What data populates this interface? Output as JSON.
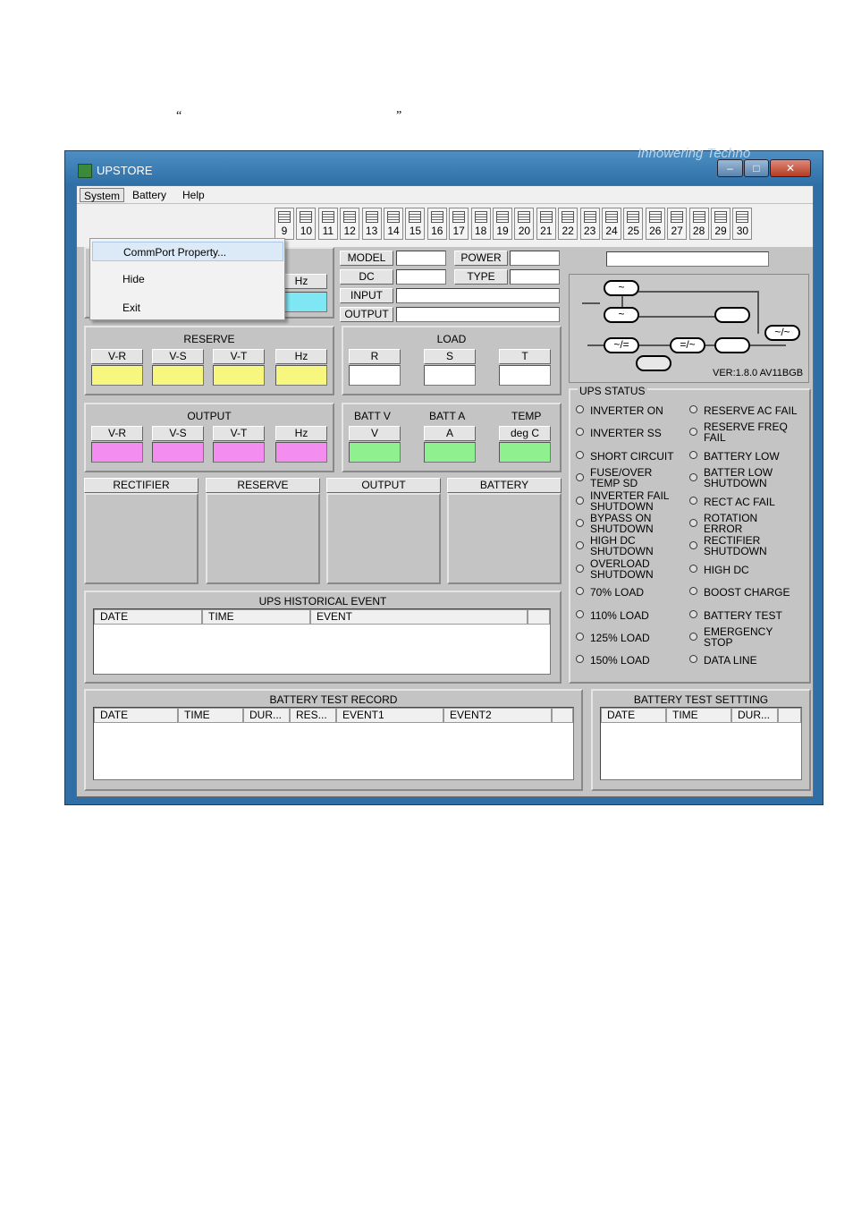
{
  "doc": {
    "quote_open": "“",
    "quote_close": "”"
  },
  "window": {
    "title": "UPSTORE",
    "brand": "Innowering Techno",
    "minimize": "‒",
    "maximize": "□",
    "close": "✕"
  },
  "menu": {
    "system": "System",
    "battery": "Battery",
    "help": "Help"
  },
  "dropdown": {
    "items": [
      "CommPort Property...",
      "Hide",
      "Exit"
    ]
  },
  "ports": [
    "9",
    "10",
    "11",
    "12",
    "13",
    "14",
    "15",
    "16",
    "17",
    "18",
    "19",
    "20",
    "21",
    "22",
    "23",
    "24",
    "25",
    "26",
    "27",
    "28",
    "29",
    "30"
  ],
  "rectifier_partial": {
    "hz": "Hz"
  },
  "reserve": {
    "title": "RESERVE",
    "labels": [
      "V-R",
      "V-S",
      "V-T",
      "Hz"
    ]
  },
  "output": {
    "title": "OUTPUT",
    "labels": [
      "V-R",
      "V-S",
      "V-T",
      "Hz"
    ]
  },
  "info": {
    "model": "MODEL",
    "power": "POWER",
    "dc": "DC",
    "type": "TYPE",
    "input": "INPUT",
    "output": "OUTPUT"
  },
  "load": {
    "title": "LOAD",
    "labels": [
      "R",
      "S",
      "T"
    ]
  },
  "batt": {
    "batt_v": "BATT  V",
    "batt_a": "BATT A",
    "temp": "TEMP",
    "labels": [
      "V",
      "A",
      "deg C"
    ]
  },
  "lists": {
    "rectifier": "RECTIFIER",
    "reserve": "RESERVE",
    "output": "OUTPUT",
    "battery": "BATTERY"
  },
  "history": {
    "title": "UPS HISTORICAL  EVENT",
    "cols": [
      "DATE",
      "TIME",
      "EVENT"
    ]
  },
  "btest_record": {
    "title": "BATTERY TEST RECORD",
    "cols": [
      "DATE",
      "TIME",
      "DUR...",
      "RES...",
      "EVENT1",
      "EVENT2"
    ]
  },
  "btest_setting": {
    "title": "BATTERY TEST SETTTING",
    "cols": [
      "DATE",
      "TIME",
      "DUR..."
    ]
  },
  "diagram": {
    "version": "VER:1.8.0 AV11BGB",
    "sym_ac": "~",
    "sym_rect": "~/=",
    "sym_dc": "=/~",
    "sym_inv": "~/~"
  },
  "status": {
    "title": "UPS STATUS",
    "left": [
      "INVERTER ON",
      "INVERTER SS",
      "SHORT CIRCUIT",
      "FUSE/OVER\nTEMP SD",
      "INVERTER FAIL\nSHUTDOWN",
      "BYPASS ON\nSHUTDOWN",
      "HIGH DC\nSHUTDOWN",
      "OVERLOAD\nSHUTDOWN",
      "70% LOAD",
      "110% LOAD",
      "125% LOAD",
      "150% LOAD"
    ],
    "right": [
      "RESERVE AC FAIL",
      "RESERVE FREQ\nFAIL",
      "BATTERY LOW",
      "BATTER LOW\nSHUTDOWN",
      "RECT AC FAIL",
      "ROTATION\nERROR",
      "RECTIFIER\nSHUTDOWN",
      "HIGH DC",
      "BOOST CHARGE",
      "BATTERY TEST",
      "EMERGENCY\nSTOP",
      "DATA LINE"
    ]
  },
  "colors": {
    "cyan": "#7fe7f4",
    "yellow": "#f7f77f",
    "magenta": "#f38ef0",
    "green": "#8ef08e"
  }
}
